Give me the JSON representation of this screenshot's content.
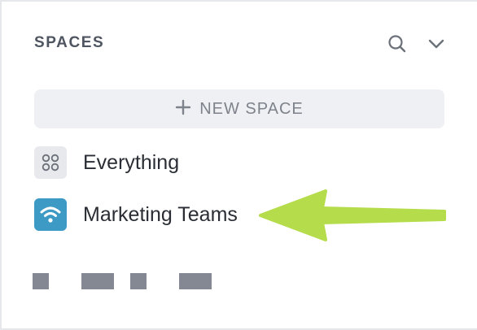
{
  "panel": {
    "title": "SPACES",
    "search_icon": "search-icon",
    "collapse_icon": "chevron-down-icon"
  },
  "new_space_button": {
    "icon": "plus-icon",
    "label": "NEW SPACE"
  },
  "spaces": [
    {
      "label": "Everything",
      "icon": "grid-icon",
      "color": "#e8e9ed"
    },
    {
      "label": "Marketing Teams",
      "icon": "wifi-icon",
      "color": "#3c9ac5"
    }
  ],
  "annotation": {
    "arrow_color": "#b5dc4a",
    "points_to": "Marketing Teams"
  },
  "redacted_blocks": 4
}
